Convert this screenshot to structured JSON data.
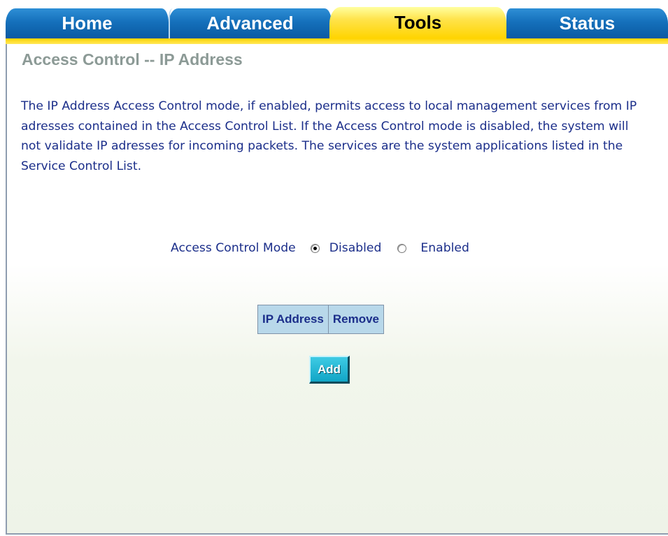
{
  "tabs": {
    "home": "Home",
    "advanced": "Advanced",
    "tools": "Tools",
    "status": "Status",
    "active": "Tools"
  },
  "page": {
    "title": "Access Control -- IP Address",
    "description": "The IP Address Access Control mode, if enabled, permits access to local management services from IP adresses contained in the Access Control List. If the Access Control mode is disabled, the system will not validate IP adresses for incoming packets. The services are the system applications listed in the Service Control List."
  },
  "access_control_mode": {
    "label": "Access Control Mode",
    "options": [
      "Disabled",
      "Enabled"
    ],
    "disabled_label": "Disabled",
    "enabled_label": "Enabled",
    "selected": "Disabled"
  },
  "ip_table": {
    "headers": [
      "IP Address",
      "Remove"
    ],
    "col_ip": "IP Address",
    "col_remove": "Remove",
    "rows": []
  },
  "add_button": "Add",
  "colors": {
    "tab_blue": "#1570bb",
    "tab_active_yellow": "#ffd400",
    "text_blue": "#1b2e8a",
    "title_gray": "#8c9a96",
    "table_header_bg": "#b8d8ea",
    "button_cyan": "#11a5c6"
  }
}
